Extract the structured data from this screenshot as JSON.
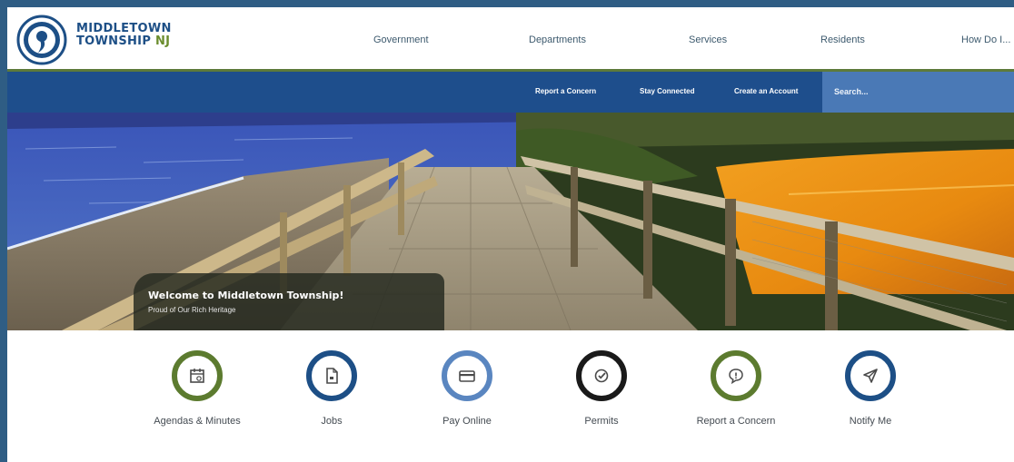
{
  "brand": {
    "line1": "MIDDLETOWN",
    "line2": "TOWNSHIP",
    "suffix": "NJ"
  },
  "nav": [
    "Government",
    "Departments",
    "Services",
    "Residents",
    "How Do I..."
  ],
  "utility": {
    "links": [
      "Report a Concern",
      "Stay Connected",
      "Create an Account"
    ],
    "search_placeholder": "Search..."
  },
  "hero": {
    "title": "Welcome to Middletown Township!",
    "subtitle": "Proud of Our Rich Heritage"
  },
  "quick_links": [
    {
      "label": "Agendas & Minutes",
      "icon": "calendar-icon",
      "color": "#5c7b2f"
    },
    {
      "label": "Jobs",
      "icon": "document-icon",
      "color": "#1d4f86"
    },
    {
      "label": "Pay Online",
      "icon": "credit-card-icon",
      "color": "#5a86c0"
    },
    {
      "label": "Permits",
      "icon": "checkmark-icon",
      "color": "#1a1a1a"
    },
    {
      "label": "Report a Concern",
      "icon": "chat-bubble-icon",
      "color": "#5c7b2f"
    },
    {
      "label": "Notify Me",
      "icon": "paper-plane-icon",
      "color": "#1d4f86"
    }
  ],
  "colors": {
    "brand_blue": "#1d4f86",
    "brand_green": "#5c7b2f",
    "utility_bar": "#1e4e8c",
    "search_box": "#4a79b6"
  }
}
